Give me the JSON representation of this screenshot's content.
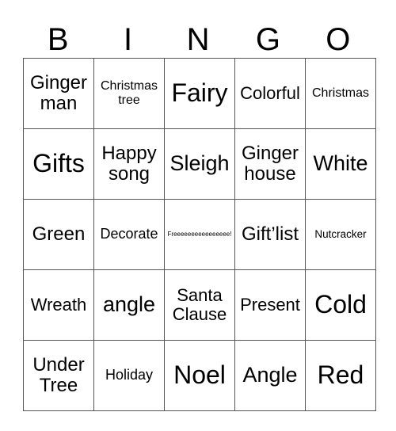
{
  "header": [
    "B",
    "I",
    "N",
    "G",
    "O"
  ],
  "rows": [
    [
      "Ginger man",
      "Christmas tree",
      "Fairy",
      "Colorful",
      "Christmas"
    ],
    [
      "Gifts",
      "Happy song",
      "Sleigh",
      "Ginger house",
      "White"
    ],
    [
      "Green",
      "Decorate",
      "Freeeeeeeeeeeeeeee!",
      "Gift’list",
      "Nutcracker"
    ],
    [
      "Wreath",
      "angle",
      "Santa Clause",
      "Present",
      "Cold"
    ],
    [
      "Under Tree",
      "Holiday",
      "Noel",
      "Angle",
      "Red"
    ]
  ]
}
